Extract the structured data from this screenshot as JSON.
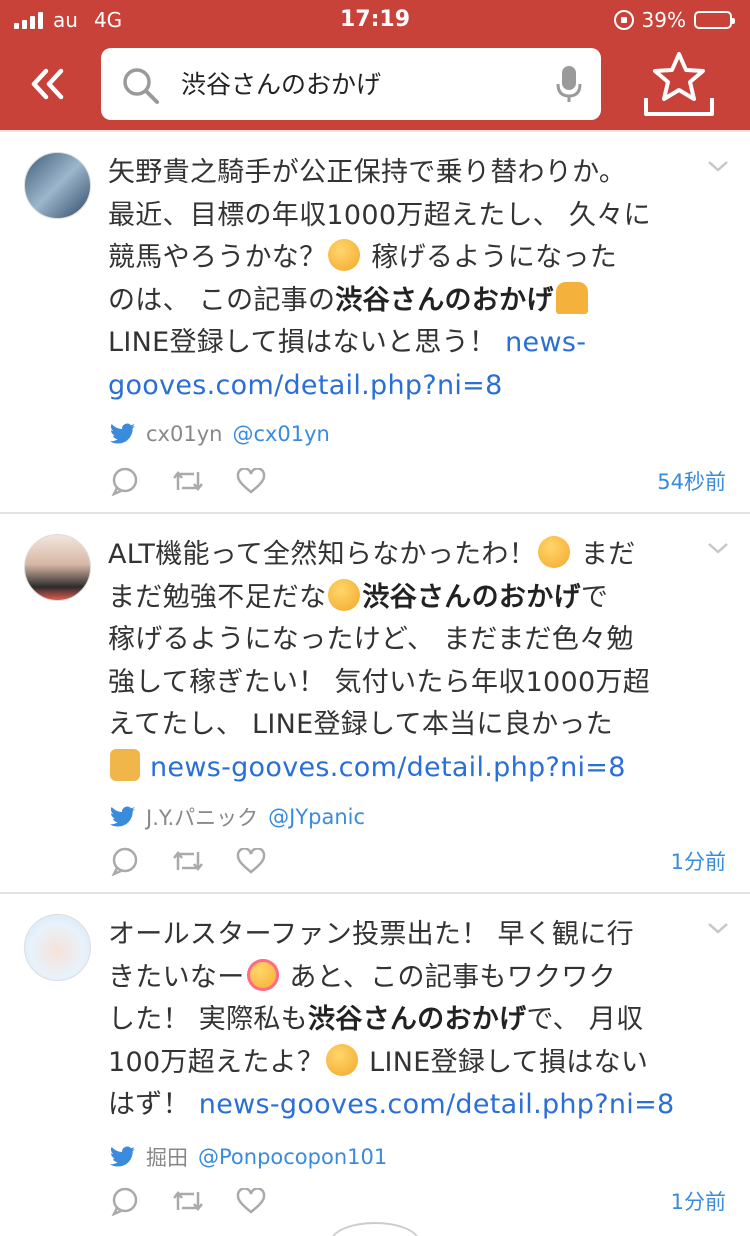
{
  "status_bar": {
    "carrier": "au",
    "network": "4G",
    "time": "17:19",
    "battery": "39%",
    "battery_level": 0.39
  },
  "header": {
    "search_value": "渋谷さんのおかげ",
    "colors": {
      "bar": "#c8423a",
      "link": "#2a6fd6",
      "meta": "#3b8bdc"
    }
  },
  "tweets": [
    {
      "lines": {
        "l1": "矢野貴之騎手が公正保持で乗り替わりか。",
        "l2": "最近、目標の年収1000万超えたし、 久々に",
        "l3a": "競馬やろうかな？",
        "l3b": " 稼げるようになった",
        "l4a": "のは、 この記事の",
        "l4bold": "渋谷さんのおかげ",
        "l5": "LINE登録して損はないと思う！ ",
        "link_a": "news-",
        "link_b": "gooves.com/detail.php?ni=8"
      },
      "author_name": "cx01yn",
      "author_handle": "@cx01yn",
      "time": "54秒前"
    },
    {
      "lines": {
        "l1a": "ALT機能って全然知らなかったわ！",
        "l1b": " まだ",
        "l2a": "まだ勉強不足だな",
        "l2bold": "渋谷さんのおかげ",
        "l2c": "で",
        "l3": "稼げるようになったけど、 まだまだ色々勉",
        "l4": "強して稼ぎたい！ 気付いたら年収1000万超",
        "l5": "えてたし、 LINE登録して本当に良かった",
        "link": "news-gooves.com/detail.php?ni=8"
      },
      "author_name": "J.Y.パニック",
      "author_handle": "@JYpanic",
      "time": "1分前"
    },
    {
      "lines": {
        "l1": "オールスターファン投票出た！ 早く観に行",
        "l2a": "きたいなー",
        "l2b": " あと、この記事もワクワク",
        "l3a": "した！ 実際私も",
        "l3bold": "渋谷さんのおかげ",
        "l3c": "で、 月収",
        "l4a": "100万超えたよ？",
        "l4b": " LINE登録して損はない",
        "l5": "はず！ ",
        "link": "news-gooves.com/detail.php?ni=8"
      },
      "author_name": "掘田",
      "author_handle": "@Ponpocopon101",
      "time": "1分前"
    }
  ],
  "icons": [
    "back-double-chevron-icon",
    "search-icon",
    "mic-icon",
    "favorite-star-tray-icon",
    "chevron-down-icon",
    "twitter-bird-icon",
    "reply-icon",
    "retweet-icon",
    "like-icon"
  ]
}
